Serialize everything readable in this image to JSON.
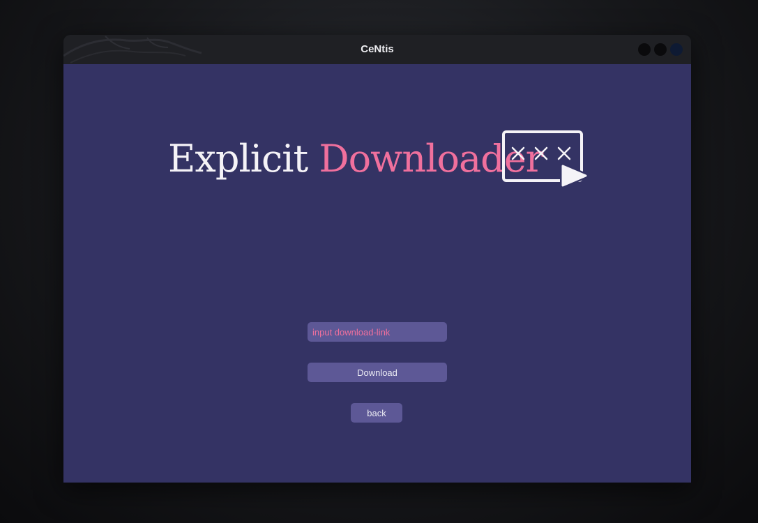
{
  "window": {
    "title": "CeNtis",
    "controls": [
      {
        "name": "minimize-button",
        "icon": "minimize-icon"
      },
      {
        "name": "maximize-button",
        "icon": "maximize-icon"
      },
      {
        "name": "close-button",
        "icon": "close-icon"
      }
    ]
  },
  "logo": {
    "word_1": "Explicit",
    "word_2": "Downloader",
    "icon": "explicit-video-icon",
    "colors": {
      "primary": "#f5f3f7",
      "accent": "#f0709d"
    }
  },
  "form": {
    "link_input": {
      "placeholder": "input download-link",
      "value": ""
    },
    "download_label": "Download",
    "back_label": "back"
  },
  "colors": {
    "background": "#343364",
    "button": "#5d5896",
    "titlebar": "#1f2024"
  }
}
